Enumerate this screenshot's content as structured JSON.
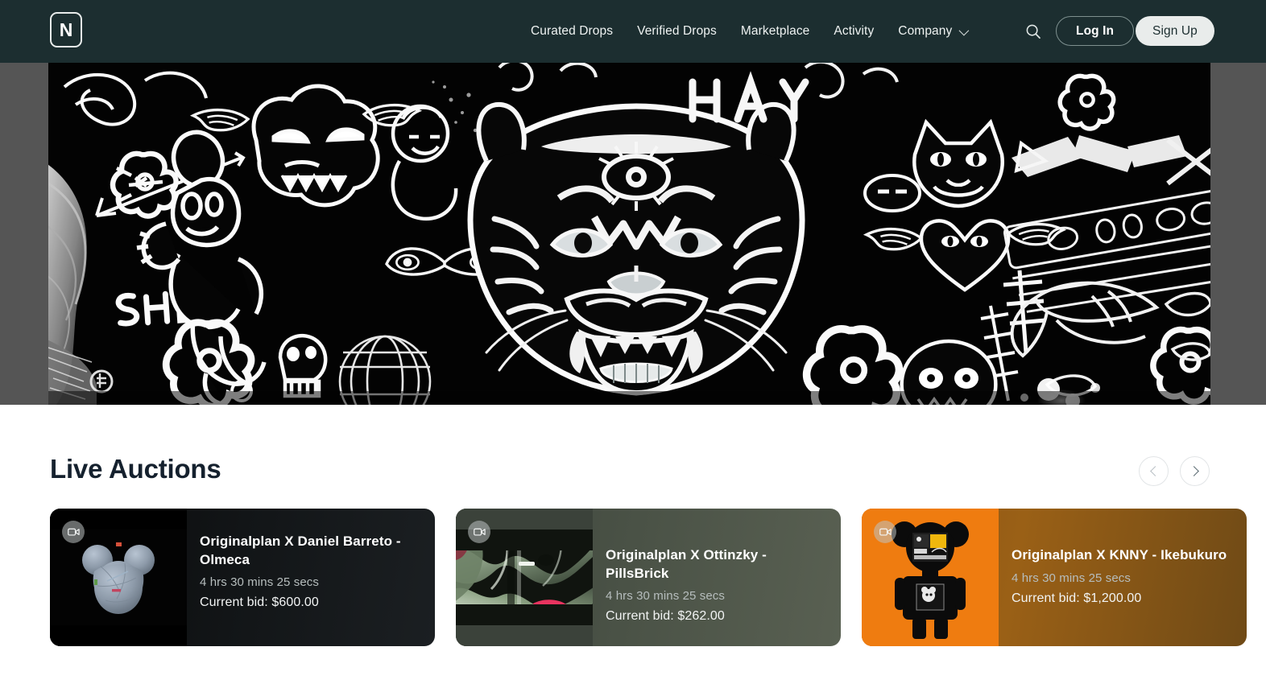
{
  "theme": {
    "header_bg": "#1c2e30",
    "page_bg": "#ffffff",
    "gutter_gray": "#555555",
    "title_color": "#15212e",
    "signup_bg": "#e9eceb"
  },
  "header": {
    "logo_letter": "N",
    "logo_icon": "logo-n-mark",
    "nav": [
      {
        "label": "Curated Drops",
        "icon": ""
      },
      {
        "label": "Verified Drops",
        "icon": ""
      },
      {
        "label": "Marketplace",
        "icon": ""
      },
      {
        "label": "Activity",
        "icon": ""
      },
      {
        "label": "Company",
        "icon": "chevron-down-icon"
      }
    ],
    "search_icon": "search-icon",
    "login_label": "Log In",
    "signup_label": "Sign Up"
  },
  "hero": {
    "alt": "black and white graffiti tattoo flash artwork banner with tiger face"
  },
  "section": {
    "title": "Live Auctions",
    "prev_icon": "chevron-left-icon",
    "next_icon": "chevron-right-icon"
  },
  "auctions": [
    {
      "title": "Originalplan X Daniel Barreto - Olmeca",
      "time_left": "4 hrs 30 mins 25 secs",
      "bid_label": "Current bid: $600.00",
      "badge_icon": "video-camera-icon",
      "media_alt": "grey stone bear figure on black"
    },
    {
      "title": "Originalplan X Ottinzky - PillsBrick",
      "time_left": "4 hrs 30 mins 25 secs",
      "bid_label": "Current bid: $262.00",
      "badge_icon": "video-camera-icon",
      "media_alt": "green glossy abstract sculpture render"
    },
    {
      "title": "Originalplan X KNNY - Ikebukuro",
      "time_left": "4 hrs 30 mins 25 secs",
      "bid_label": "Current bid: $1,200.00",
      "badge_icon": "video-camera-icon",
      "media_alt": "black bearbrick figure on orange background"
    }
  ]
}
